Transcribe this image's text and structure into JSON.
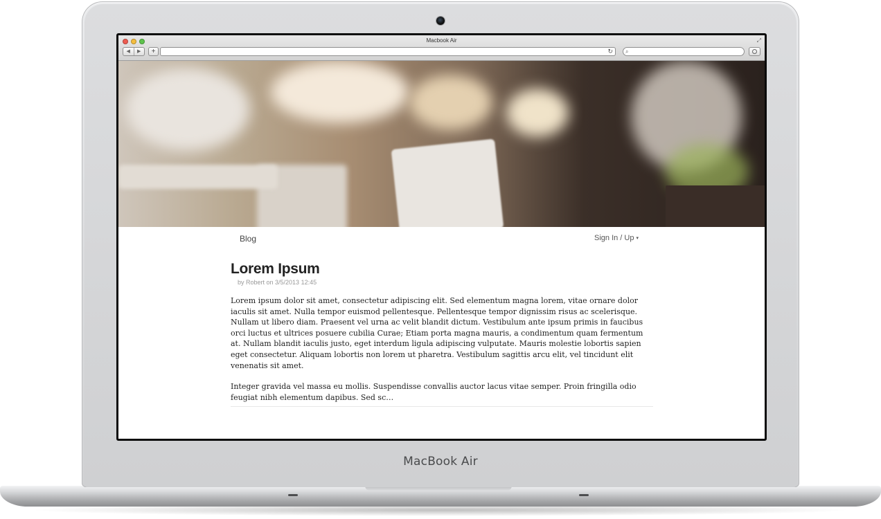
{
  "device": {
    "brand_label": "MacBook Air"
  },
  "browser": {
    "window_title": "Macbook Air",
    "back_icon": "◀",
    "forward_icon": "▶",
    "new_tab_icon": "+",
    "reload_icon": "↻",
    "search_icon": "🔍"
  },
  "site_nav": {
    "blog_link": "Blog",
    "sign_in_label": "Sign In / Up",
    "caret_icon": "▾"
  },
  "post": {
    "title": "Lorem Ipsum",
    "meta": "by Robert on 3/5/2013 12:45",
    "paragraphs": [
      "Lorem ipsum dolor sit amet, consectetur adipiscing elit. Sed elementum magna lorem, vitae ornare dolor iaculis sit amet. Nulla tempor euismod pellentesque. Pellentesque tempor dignissim risus ac scelerisque. Nullam ut libero diam. Praesent vel urna ac velit blandit dictum. Vestibulum ante ipsum primis in faucibus orci luctus et ultrices posuere cubilia Curae; Etiam porta magna mauris, a condimentum quam fermentum at. Nullam blandit iaculis justo, eget interdum ligula adipiscing vulputate. Mauris molestie lobortis sapien eget consectetur. Aliquam lobortis non lorem ut pharetra. Vestibulum sagittis arcu elit, vel tincidunt elit venenatis sit amet.",
      "Integer gravida vel massa eu mollis. Suspendisse convallis auctor lacus vitae semper. Proin fringilla odio feugiat nibh elementum dapibus. Sed sc…"
    ]
  }
}
